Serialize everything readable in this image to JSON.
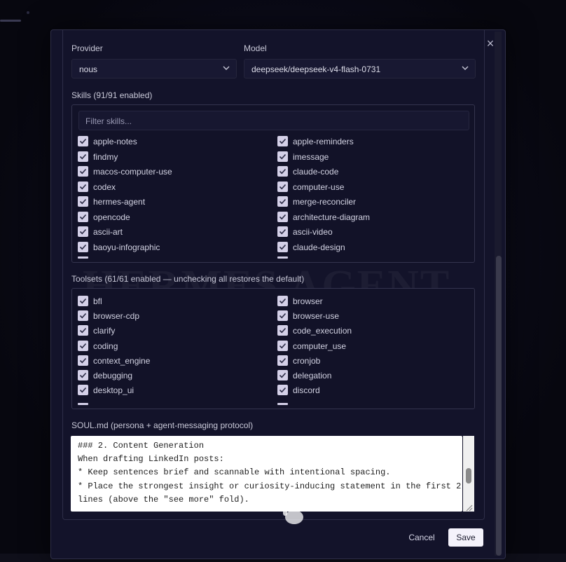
{
  "dialog": {
    "watermark": "HERMES AGENT",
    "close_symbol": "×"
  },
  "provider": {
    "label": "Provider",
    "value": "nous"
  },
  "model": {
    "label": "Model",
    "value": "deepseek/deepseek-v4-flash-0731"
  },
  "skills": {
    "label": "Skills (91/91 enabled)",
    "filter_placeholder": "Filter skills...",
    "left": [
      "apple-notes",
      "findmy",
      "macos-computer-use",
      "codex",
      "hermes-agent",
      "opencode",
      "ascii-art",
      "baoyu-infographic"
    ],
    "right": [
      "apple-reminders",
      "imessage",
      "claude-code",
      "computer-use",
      "merge-reconciler",
      "architecture-diagram",
      "ascii-video",
      "claude-design"
    ]
  },
  "toolsets": {
    "label": "Toolsets (61/61 enabled — unchecking all restores the default)",
    "left": [
      "bfl",
      "browser-cdp",
      "clarify",
      "coding",
      "context_engine",
      "debugging",
      "desktop_ui"
    ],
    "right": [
      "browser",
      "browser-use",
      "code_execution",
      "computer_use",
      "cronjob",
      "delegation",
      "discord"
    ]
  },
  "soul": {
    "label": "SOUL.md (persona + agent-messaging protocol)",
    "lines": [
      "### 2. Content Generation",
      "When drafting LinkedIn posts:",
      "* Keep sentences brief and scannable with intentional spacing.",
      "* Place the strongest insight or curiosity-inducing statement in the first 2",
      "lines (above the \"see more\" fold)."
    ]
  },
  "actions": {
    "cancel": "Cancel",
    "save": "Save"
  },
  "colors": {
    "accent": "#f4f2fb",
    "checkbox": "#d4d0e8",
    "dialog_bg": "#13132a"
  }
}
